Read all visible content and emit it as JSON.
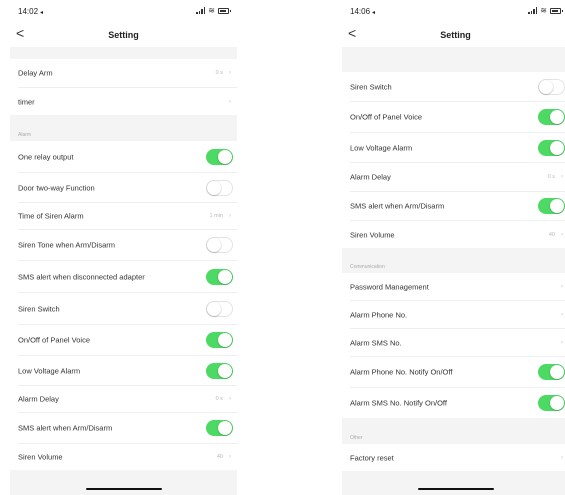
{
  "left": {
    "time": "14:02",
    "loc": "◂",
    "title": "Setting",
    "back": "<",
    "rows": [
      {
        "label": "Delay Arm",
        "value": "0 s",
        "type": "chevron"
      },
      {
        "label": "timer",
        "value": "",
        "type": "chevron"
      },
      {
        "label": "One relay output",
        "type": "toggle",
        "on": true
      },
      {
        "label": "Door two-way Function",
        "type": "toggle",
        "on": false
      },
      {
        "label": "Time of Siren Alarm",
        "value": "1 min",
        "type": "chevron"
      },
      {
        "label": "Siren Tone when Arm/Disarm",
        "type": "toggle",
        "on": false
      },
      {
        "label": "SMS alert when disconnected adapter",
        "type": "toggle",
        "on": true
      },
      {
        "label": "Siren Switch",
        "type": "toggle",
        "on": false
      },
      {
        "label": "On/Off of Panel Voice",
        "type": "toggle",
        "on": true
      },
      {
        "label": "Low Voltage Alarm",
        "type": "toggle",
        "on": true
      },
      {
        "label": "Alarm Delay",
        "value": "0 s",
        "type": "chevron"
      },
      {
        "label": "SMS alert when Arm/Disarm",
        "type": "toggle",
        "on": true
      },
      {
        "label": "Siren Volume",
        "value": "40",
        "type": "chevron"
      }
    ],
    "section_alarm": "Alarm"
  },
  "right": {
    "time": "14:06",
    "loc": "◂",
    "title": "Setting",
    "back": "<",
    "rows": [
      {
        "label": "Siren Switch",
        "type": "toggle",
        "on": false
      },
      {
        "label": "On/Off of Panel Voice",
        "type": "toggle",
        "on": true
      },
      {
        "label": "Low Voltage Alarm",
        "type": "toggle",
        "on": true
      },
      {
        "label": "Alarm Delay",
        "value": "0 s",
        "type": "chevron"
      },
      {
        "label": "SMS alert when Arm/Disarm",
        "type": "toggle",
        "on": true
      },
      {
        "label": "Siren Volume",
        "value": "40",
        "type": "chevron"
      },
      {
        "label": "Password Management",
        "type": "chevron"
      },
      {
        "label": "Alarm Phone No.",
        "type": "chevron"
      },
      {
        "label": "Alarm SMS No.",
        "type": "chevron"
      },
      {
        "label": "Alarm Phone No. Notify On/Off",
        "type": "toggle",
        "on": true
      },
      {
        "label": "Alarm SMS No. Notify On/Off",
        "type": "toggle",
        "on": true
      },
      {
        "label": "Factory reset",
        "type": "chevron"
      }
    ],
    "section_comm": "Communication",
    "section_other": "Other"
  },
  "chevron": "›",
  "colors": {
    "toggle_on": "#4cd964",
    "section_band": "#f4f4f4"
  }
}
